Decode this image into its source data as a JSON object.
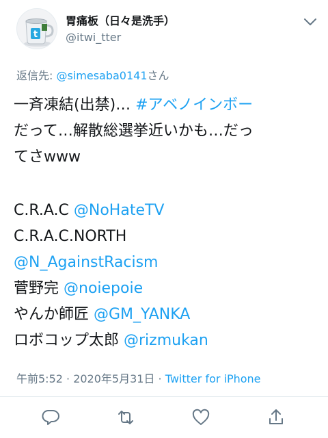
{
  "profile": {
    "display_name": "胃痛板（日々是洗手）",
    "handle": "@itwi_tter"
  },
  "reply": {
    "prefix": "返信先: ",
    "mention": "@simesaba0141",
    "suffix": "さん"
  },
  "tweet": {
    "l1_text": "一斉凍結(出禁)… ",
    "l1_hashtag": "#アベノインボー",
    "l2": "だって…解散総選挙近いかも…だっ",
    "l3": "てさwww",
    "l5_text": "C.R.A.C ",
    "l5_link": "@NoHateTV",
    "l6": "C.R.A.C.NORTH",
    "l7_link": "@N_AgainstRacism",
    "l8_text": " 菅野完 ",
    "l8_link": "@noiepoie",
    "l9_text": "やんか師匠 ",
    "l9_link": "@GM_YANKA",
    "l10_text": "ロボコップ太郎 ",
    "l10_link": "@rizmukan"
  },
  "meta": {
    "time": "午前5:52 · 2020年5月31日 · ",
    "source": "Twitter for iPhone"
  },
  "icons": {
    "avatar": "coffee-mug-with-twitter-logo",
    "menu": "chevron-down-icon",
    "reply": "reply-icon",
    "retweet": "retweet-icon",
    "like": "heart-icon",
    "share": "share-icon"
  },
  "colors": {
    "accent": "#1da1f2",
    "secondary_text": "#657786",
    "icon": "#657786"
  }
}
